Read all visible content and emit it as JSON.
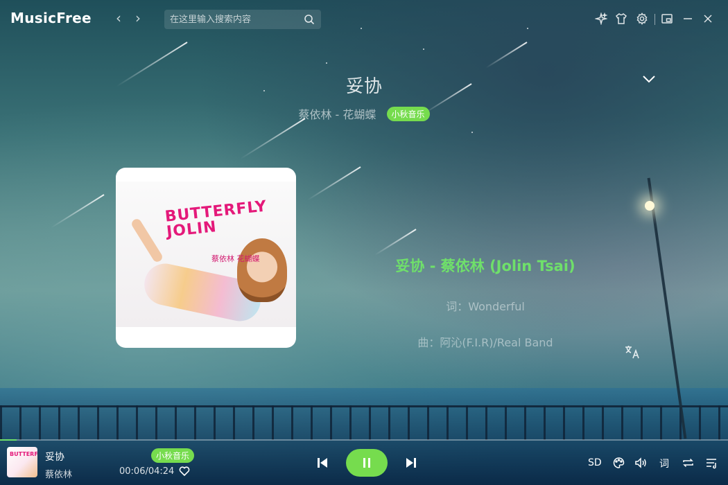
{
  "app": {
    "name": "MusicFree"
  },
  "header": {
    "search_placeholder": "在这里输入搜索内容"
  },
  "song": {
    "title": "妥协",
    "artist": "蔡依林",
    "album": "花蝴蝶",
    "artist_album": "蔡依林 - 花蝴蝶",
    "source_tag": "小秋音乐"
  },
  "album_art": {
    "logo_text": "BUTTERFLY JOLIN",
    "sub_text": "蔡依林 花蝴蝶"
  },
  "lyrics": {
    "current": "妥协 - 蔡依林 (Jolin Tsai)",
    "lines": [
      "词：Wonderful",
      "曲：阿沁(F.I.R)/Real Band"
    ]
  },
  "player": {
    "current_time": "00:06",
    "total_time": "04:24",
    "time_display": "00:06/04:24",
    "progress_fraction": 0.023,
    "quality": "SD",
    "lyric_label": "词"
  },
  "colors": {
    "accent": "#76dc4e",
    "lyric_highlight": "#6fe06a"
  },
  "icons": {
    "theme": "sparkle-icon",
    "skin": "shirt-icon",
    "settings": "gear-icon",
    "mini_mode": "mini-window-icon",
    "minimize": "minimize-icon",
    "close": "close-icon"
  }
}
